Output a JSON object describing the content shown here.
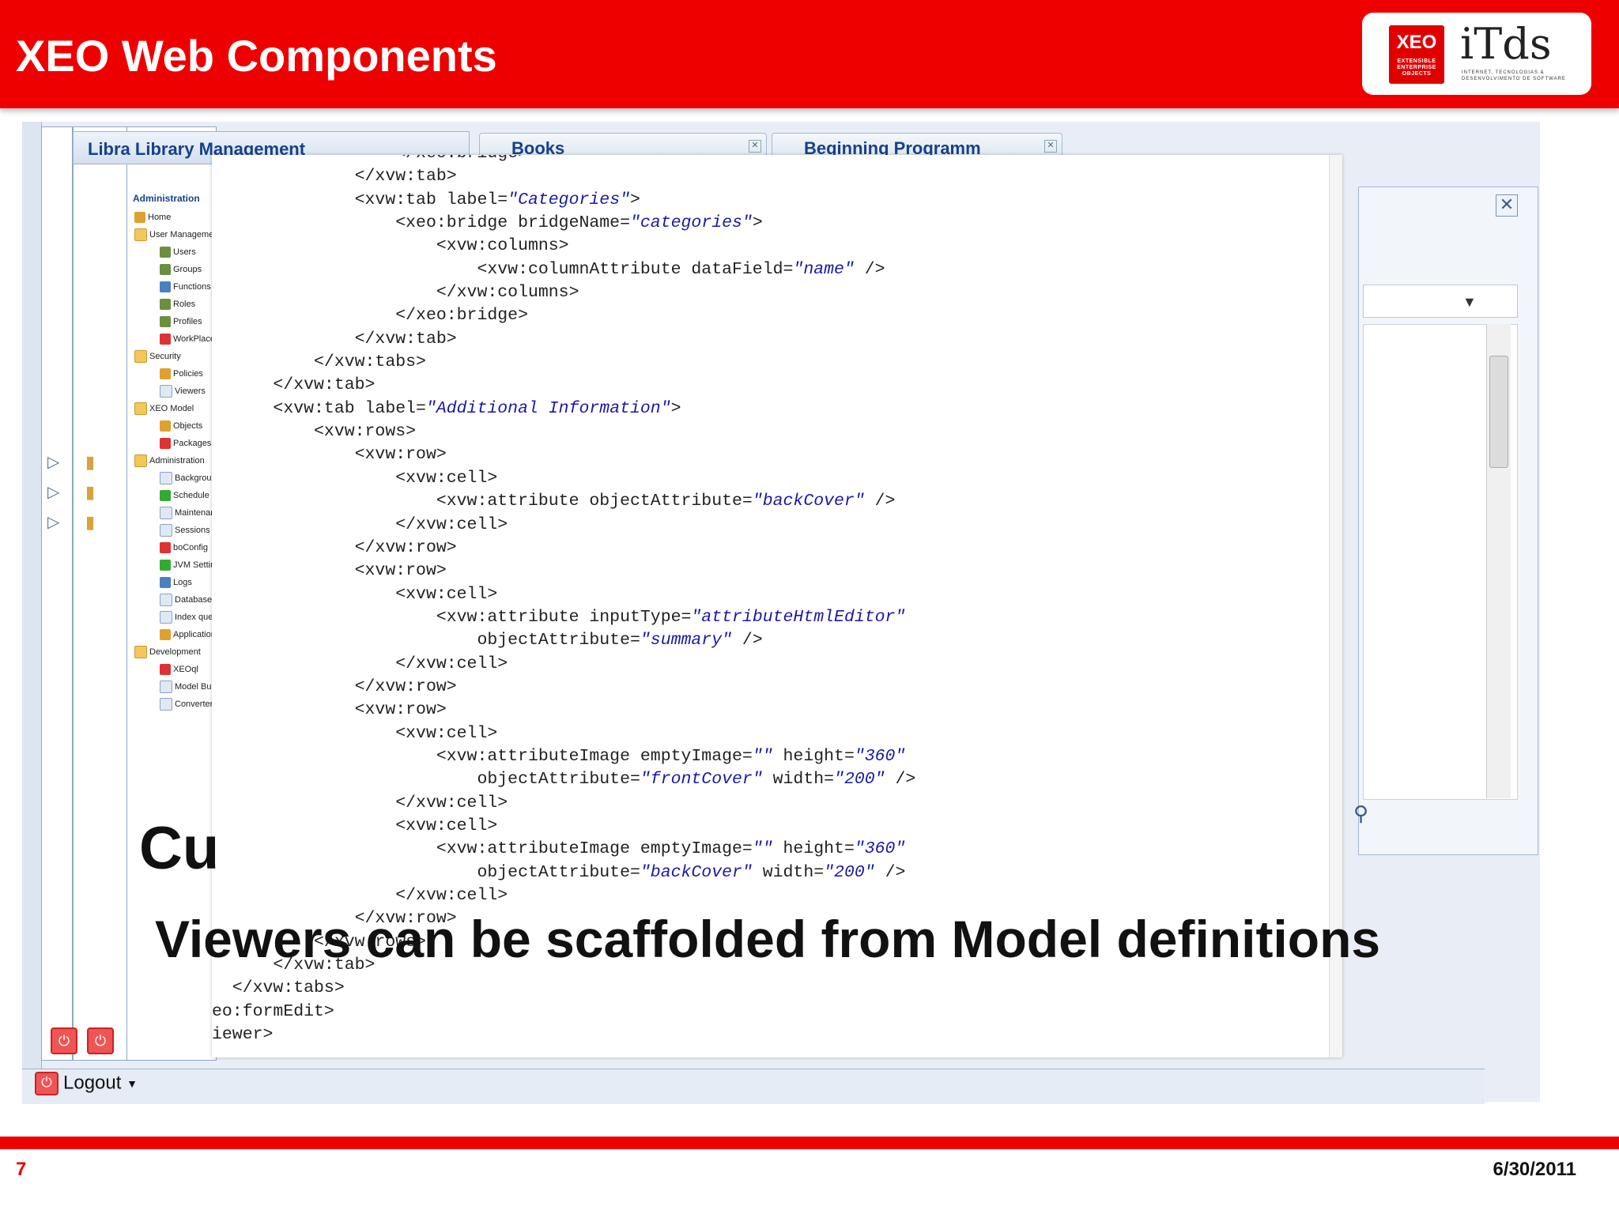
{
  "header": {
    "title": "XEO Web Components",
    "logo_xeo": "XEO",
    "logo_xeo_sub": "EXTENSIBLE ENTERPRISE OBJECTS",
    "logo_itds": "iTds",
    "logo_itds_sub": "INTERNET, TECNOLOGIAS & DESENVOLVIMENTO DE SOFTWARE"
  },
  "background_app": {
    "title": "Libra Library Management",
    "tabs": [
      "Books",
      "Beginning Programm"
    ],
    "close_glyph": "✕",
    "logout_label": "Logout",
    "small_logout_label": "Logout",
    "admin_tree": {
      "title": "Administration",
      "items": [
        {
          "label": "Home",
          "level": 0,
          "icon": "home"
        },
        {
          "label": "User Management",
          "level": 0,
          "icon": "folder"
        },
        {
          "label": "Users",
          "level": 1,
          "icon": "user"
        },
        {
          "label": "Groups",
          "level": 1,
          "icon": "user"
        },
        {
          "label": "Functions",
          "level": 1,
          "icon": "function"
        },
        {
          "label": "Roles",
          "level": 1,
          "icon": "user"
        },
        {
          "label": "Profiles",
          "level": 1,
          "icon": "user"
        },
        {
          "label": "WorkPlaces",
          "level": 1,
          "icon": "red"
        },
        {
          "label": "Security",
          "level": 0,
          "icon": "folder"
        },
        {
          "label": "Policies",
          "level": 1,
          "icon": "gear"
        },
        {
          "label": "Viewers",
          "level": 1,
          "icon": "page"
        },
        {
          "label": "XEO Model",
          "level": 0,
          "icon": "folder"
        },
        {
          "label": "Objects",
          "level": 1,
          "icon": "gear"
        },
        {
          "label": "Packages",
          "level": 1,
          "icon": "red"
        },
        {
          "label": "Administration",
          "level": 0,
          "icon": "folder"
        },
        {
          "label": "Background",
          "level": 1,
          "icon": "page"
        },
        {
          "label": "Schedule",
          "level": 1,
          "icon": "green"
        },
        {
          "label": "Maintenance",
          "level": 1,
          "icon": "page"
        },
        {
          "label": "Sessions",
          "level": 1,
          "icon": "page"
        },
        {
          "label": "boConfig",
          "level": 1,
          "icon": "red"
        },
        {
          "label": "JVM Settings",
          "level": 1,
          "icon": "green"
        },
        {
          "label": "Logs",
          "level": 1,
          "icon": "blue"
        },
        {
          "label": "Database",
          "level": 1,
          "icon": "page"
        },
        {
          "label": "Index queue",
          "level": 1,
          "icon": "page"
        },
        {
          "label": "Applications",
          "level": 1,
          "icon": "gear"
        },
        {
          "label": "Development",
          "level": 0,
          "icon": "folder"
        },
        {
          "label": "XEOql",
          "level": 1,
          "icon": "red"
        },
        {
          "label": "Model Builder",
          "level": 1,
          "icon": "page"
        },
        {
          "label": "Converter",
          "level": 1,
          "icon": "page"
        }
      ]
    }
  },
  "code_lines": [
    "                  </xeo:bridge>",
    "              </xvw:tab>",
    "              <xvw:tab label=\"Categories\">",
    "                  <xeo:bridge bridgeName=\"categories\">",
    "                      <xvw:columns>",
    "                          <xvw:columnAttribute dataField=\"name\" />",
    "                      </xvw:columns>",
    "                  </xeo:bridge>",
    "              </xvw:tab>",
    "          </xvw:tabs>",
    "      </xvw:tab>",
    "      <xvw:tab label=\"Additional Information\">",
    "          <xvw:rows>",
    "              <xvw:row>",
    "                  <xvw:cell>",
    "                      <xvw:attribute objectAttribute=\"backCover\" />",
    "                  </xvw:cell>",
    "              </xvw:row>",
    "              <xvw:row>",
    "                  <xvw:cell>",
    "                      <xvw:attribute inputType=\"attributeHtmlEditor\"",
    "                          objectAttribute=\"summary\" />",
    "                  </xvw:cell>",
    "              </xvw:row>",
    "              <xvw:row>",
    "                  <xvw:cell>",
    "                      <xvw:attributeImage emptyImage=\"\" height=\"360\"",
    "                          objectAttribute=\"frontCover\" width=\"200\" />",
    "                  </xvw:cell>",
    "                  <xvw:cell>",
    "                      <xvw:attributeImage emptyImage=\"\" height=\"360\"",
    "                          objectAttribute=\"backCover\" width=\"200\" />",
    "                  </xvw:cell>",
    "              </xvw:row>",
    "          </xvw:rows>",
    "      </xvw:tab>",
    "  </xvw:tabs>",
    "eo:formEdit>",
    "iewer>"
  ],
  "slide": {
    "cu_text": "Cu",
    "caption": "Viewers can be scaffolded from Model definitions"
  },
  "footer": {
    "page_number": "7",
    "date": "6/30/2011"
  },
  "colors": {
    "brand_red": "#ee0000",
    "attr_value": "#1a1aa6",
    "app_blue": "#15428b"
  }
}
